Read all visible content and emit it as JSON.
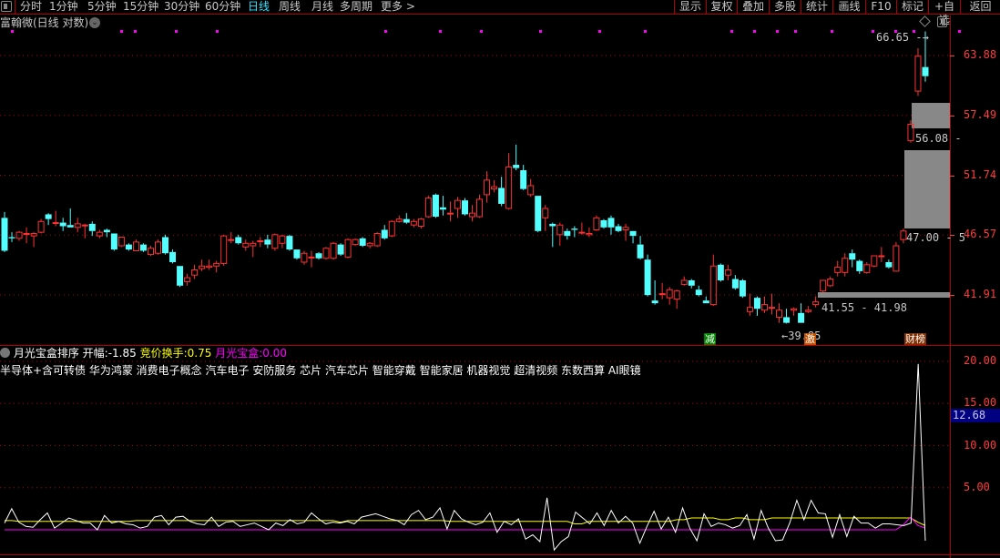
{
  "toolbar": {
    "periods": [
      {
        "label": "分时"
      },
      {
        "label": "1分钟"
      },
      {
        "label": "5分钟"
      },
      {
        "label": "15分钟"
      },
      {
        "label": "30分钟"
      },
      {
        "label": "60分钟"
      },
      {
        "label": "日线",
        "active": true
      },
      {
        "label": "周线"
      },
      {
        "label": "月线"
      },
      {
        "label": "多周期"
      },
      {
        "label": "更多 >"
      }
    ],
    "buttons": [
      {
        "label": "显示"
      },
      {
        "label": "复权"
      },
      {
        "label": "叠加"
      },
      {
        "label": "多股"
      },
      {
        "label": "统计"
      },
      {
        "label": "画线"
      },
      {
        "label": "F10"
      },
      {
        "label": "标记"
      },
      {
        "label": "+自选"
      },
      {
        "label": "返回"
      }
    ]
  },
  "chart": {
    "title": "富翰微(日线 对数)",
    "scale": "log",
    "y_ticks": [
      "63.88",
      "57.49",
      "51.74",
      "46.57",
      "41.91"
    ],
    "colors": {
      "up": "#ff3232",
      "down": "#54ffff",
      "grid": "#b00000",
      "zone": "#888888",
      "signal_dot": "#ff00ff"
    },
    "annotations": {
      "high": "66.65",
      "low": "39.85",
      "zone_top": "56.08",
      "zone_mid": "47.00 - 5",
      "zone_low": "41.55 - 41.98"
    },
    "markers": [
      {
        "label": "减",
        "color": "#008000"
      },
      {
        "label": "激",
        "color": "#c05000"
      },
      {
        "label": "财榜",
        "color": "#803000"
      }
    ],
    "candles_ohlc": [
      [
        48.0,
        48.5,
        45.2,
        45.3
      ],
      [
        46.4,
        46.8,
        46.0,
        46.3
      ],
      [
        46.3,
        46.9,
        46.1,
        46.8
      ],
      [
        46.7,
        47.2,
        45.9,
        46.7
      ],
      [
        46.5,
        46.8,
        45.6,
        46.7
      ],
      [
        46.8,
        47.9,
        46.7,
        47.7
      ],
      [
        48.3,
        48.4,
        47.4,
        47.9
      ],
      [
        47.6,
        48.6,
        47.3,
        47.6
      ],
      [
        47.6,
        48.0,
        46.9,
        47.3
      ],
      [
        47.4,
        48.8,
        47.2,
        47.2
      ],
      [
        47.2,
        48.0,
        46.8,
        47.5
      ],
      [
        47.4,
        47.5,
        46.3,
        47.4
      ],
      [
        47.5,
        47.7,
        46.5,
        46.9
      ],
      [
        46.5,
        47.0,
        46.3,
        46.8
      ],
      [
        47.0,
        47.1,
        46.4,
        46.8
      ],
      [
        46.7,
        46.7,
        45.3,
        45.4
      ],
      [
        45.7,
        46.4,
        45.6,
        46.4
      ],
      [
        45.8,
        45.9,
        45.3,
        45.4
      ],
      [
        45.3,
        46.2,
        45.3,
        46.0
      ],
      [
        45.8,
        45.9,
        45.2,
        45.3
      ],
      [
        45.0,
        45.7,
        44.9,
        45.5
      ],
      [
        45.1,
        46.2,
        45.0,
        46.0
      ],
      [
        46.4,
        46.6,
        45.0,
        45.1
      ],
      [
        45.2,
        45.4,
        44.3,
        44.4
      ],
      [
        44.1,
        44.1,
        42.5,
        42.6
      ],
      [
        42.9,
        43.5,
        42.6,
        43.2
      ],
      [
        43.4,
        44.2,
        43.1,
        43.8
      ],
      [
        43.9,
        44.6,
        43.7,
        44.1
      ],
      [
        44.0,
        44.6,
        43.8,
        44.1
      ],
      [
        44.1,
        44.5,
        43.6,
        44.3
      ],
      [
        44.3,
        46.6,
        44.1,
        46.5
      ],
      [
        46.2,
        46.8,
        45.9,
        46.2
      ],
      [
        46.4,
        46.6,
        45.8,
        45.9
      ],
      [
        45.6,
        46.2,
        45.3,
        45.9
      ],
      [
        45.7,
        46.1,
        44.8,
        45.9
      ],
      [
        46.1,
        46.4,
        45.6,
        46.1
      ],
      [
        46.2,
        46.6,
        45.5,
        45.8
      ],
      [
        45.5,
        46.7,
        45.3,
        46.6
      ],
      [
        45.9,
        46.6,
        45.5,
        46.5
      ],
      [
        46.5,
        46.6,
        45.3,
        45.4
      ],
      [
        45.4,
        45.4,
        44.6,
        44.7
      ],
      [
        44.4,
        45.3,
        44.2,
        45.1
      ],
      [
        44.8,
        45.3,
        44.0,
        44.8
      ],
      [
        45.1,
        45.2,
        44.6,
        44.7
      ],
      [
        44.7,
        45.6,
        44.6,
        45.5
      ],
      [
        44.7,
        46.0,
        44.6,
        45.9
      ],
      [
        45.8,
        45.9,
        44.9,
        45.0
      ],
      [
        44.8,
        46.3,
        44.7,
        46.2
      ],
      [
        45.8,
        46.3,
        45.7,
        46.2
      ],
      [
        46.3,
        46.4,
        45.6,
        45.7
      ],
      [
        45.7,
        46.0,
        45.5,
        45.9
      ],
      [
        45.7,
        46.8,
        45.6,
        46.7
      ],
      [
        47.0,
        47.4,
        46.2,
        46.3
      ],
      [
        46.5,
        47.8,
        46.4,
        47.7
      ],
      [
        47.7,
        48.2,
        47.6,
        47.9
      ],
      [
        47.9,
        48.4,
        47.5,
        47.6
      ],
      [
        47.4,
        47.9,
        47.2,
        47.7
      ],
      [
        47.3,
        48.0,
        47.1,
        47.9
      ],
      [
        48.1,
        49.9,
        48.0,
        49.7
      ],
      [
        50.0,
        50.1,
        48.0,
        48.1
      ],
      [
        48.9,
        49.9,
        48.2,
        48.7
      ],
      [
        48.4,
        49.4,
        47.7,
        48.4
      ],
      [
        48.8,
        49.8,
        48.0,
        49.5
      ],
      [
        49.5,
        49.7,
        48.2,
        48.3
      ],
      [
        48.1,
        49.1,
        47.7,
        48.4
      ],
      [
        48.1,
        50.0,
        48.0,
        49.6
      ],
      [
        50.0,
        52.1,
        49.3,
        51.3
      ],
      [
        50.5,
        51.3,
        50.2,
        50.7
      ],
      [
        50.6,
        51.6,
        49.0,
        49.2
      ],
      [
        48.8,
        53.8,
        48.7,
        52.5
      ],
      [
        52.7,
        54.6,
        52.2,
        52.4
      ],
      [
        52.2,
        52.7,
        50.4,
        50.5
      ],
      [
        50.0,
        51.4,
        49.8,
        50.8
      ],
      [
        49.9,
        49.9,
        46.8,
        46.9
      ],
      [
        48.0,
        49.1,
        46.9,
        48.8
      ],
      [
        47.5,
        47.6,
        45.6,
        47.3
      ],
      [
        46.6,
        47.6,
        45.7,
        47.4
      ],
      [
        46.9,
        47.1,
        46.2,
        46.5
      ],
      [
        47.1,
        47.3,
        46.4,
        47.0
      ],
      [
        46.8,
        47.6,
        46.6,
        46.8
      ],
      [
        46.6,
        47.2,
        46.4,
        46.7
      ],
      [
        47.0,
        48.2,
        46.9,
        48.0
      ],
      [
        47.8,
        47.9,
        47.1,
        47.2
      ],
      [
        48.0,
        48.2,
        46.6,
        47.2
      ],
      [
        47.3,
        47.5,
        46.8,
        46.9
      ],
      [
        47.0,
        47.5,
        46.1,
        47.2
      ],
      [
        46.9,
        46.9,
        45.9,
        46.5
      ],
      [
        45.8,
        46.5,
        44.6,
        44.7
      ],
      [
        44.6,
        45.0,
        41.8,
        41.9
      ],
      [
        41.5,
        43.0,
        41.2,
        41.3
      ],
      [
        42.0,
        42.8,
        41.6,
        42.0
      ],
      [
        41.7,
        42.5,
        41.2,
        42.3
      ],
      [
        41.6,
        42.3,
        40.9,
        42.2
      ],
      [
        42.7,
        43.3,
        42.6,
        43.0
      ],
      [
        43.0,
        43.1,
        42.4,
        42.6
      ],
      [
        42.3,
        42.6,
        41.8,
        41.9
      ],
      [
        41.5,
        41.8,
        41.3,
        41.3
      ],
      [
        41.2,
        45.0,
        41.1,
        44.1
      ],
      [
        44.2,
        44.3,
        42.9,
        43.0
      ],
      [
        43.4,
        44.2,
        43.0,
        43.8
      ],
      [
        43.1,
        43.4,
        42.3,
        42.4
      ],
      [
        43.0,
        43.1,
        41.7,
        41.8
      ],
      [
        40.7,
        42.0,
        40.4,
        41.0
      ],
      [
        41.7,
        41.8,
        40.4,
        40.9
      ],
      [
        40.8,
        41.8,
        40.6,
        41.2
      ],
      [
        41.0,
        42.0,
        40.5,
        41.0
      ],
      [
        40.3,
        41.3,
        39.9,
        40.8
      ],
      [
        40.3,
        40.9,
        39.85,
        39.9
      ],
      [
        40.8,
        41.0,
        40.4,
        40.9
      ],
      [
        40.6,
        41.3,
        39.9,
        39.9
      ],
      [
        40.7,
        41.1,
        40.6,
        40.8
      ],
      [
        41.2,
        41.8,
        41.0,
        41.4
      ],
      [
        42.2,
        43.0,
        42.1,
        43.0
      ],
      [
        42.6,
        43.3,
        42.5,
        43.1
      ],
      [
        43.6,
        44.5,
        43.3,
        44.0
      ],
      [
        43.6,
        45.1,
        43.3,
        44.7
      ],
      [
        45.1,
        45.4,
        44.0,
        44.6
      ],
      [
        44.5,
        44.6,
        43.5,
        43.7
      ],
      [
        43.6,
        44.4,
        43.5,
        44.2
      ],
      [
        44.1,
        44.9,
        44.0,
        44.9
      ],
      [
        44.9,
        45.6,
        44.4,
        44.9
      ],
      [
        44.4,
        44.6,
        43.9,
        44.0
      ],
      [
        43.7,
        46.0,
        43.7,
        45.7
      ],
      [
        46.2,
        47.1,
        45.9,
        46.9
      ],
      [
        55.0,
        57.0,
        54.8,
        56.6
      ],
      [
        60.0,
        64.7,
        59.5,
        63.8
      ],
      [
        62.6,
        66.65,
        61.0,
        61.6
      ]
    ],
    "signal_dot_candles": [
      0,
      24,
      27,
      36,
      45,
      82,
      94,
      103,
      116,
      129,
      139,
      158,
      163,
      168,
      172,
      180,
      189,
      194,
      198,
      208
    ]
  },
  "indicator": {
    "name": "月光宝盒排序",
    "open_label": "开幅:",
    "open_value": "-1.85",
    "auction_label": "竞价换手:",
    "auction_value": "0.75",
    "box_label": "月光宝盒:",
    "box_value": "0.00",
    "tags": "半导体+含可转债 华为鸿蒙 消费电子概念 汽车电子 安防服务 芯片 汽车芯片 智能穿戴 智能家居 机器视觉 超清视频 东数西算 AI眼镜",
    "y_ticks": [
      "20.00",
      "15.00",
      "10.00",
      "5.00"
    ],
    "current_value": "12.68",
    "colors": {
      "main": "#ffffff",
      "auction": "#ffff00",
      "box": "#ff00ff"
    },
    "main_values": [
      0.8,
      2.5,
      0.9,
      0.4,
      0.3,
      1.2,
      2.0,
      0.2,
      0.8,
      1.4,
      1.1,
      0.8,
      0.8,
      0.0,
      1.7,
      0.8,
      1.0,
      0.7,
      0.6,
      0.2,
      0.4,
      1.5,
      1.7,
      0.6,
      1.5,
      1.6,
      1.0,
      0.7,
      0.6,
      1.5,
      0.4,
      0.9,
      1.0,
      0.4,
      0.6,
      0.8,
      0.4,
      0.0,
      0.8,
      0.5,
      1.2,
      0.7,
      0.9,
      2.0,
      1.3,
      0.7,
      0.9,
      0.8,
      1.0,
      0.7,
      1.5,
      1.7,
      1.9,
      1.6,
      1.3,
      1.1,
      0.6,
      1.8,
      2.3,
      1.2,
      1.5,
      2.6,
      0.1,
      2.3,
      1.3,
      0.9,
      0.6,
      0.9,
      2.0,
      -0.3,
      1.0,
      0.6,
      1.3,
      -1.1,
      -0.6,
      -1.4,
      3.8,
      -2.4,
      -1.4,
      -0.8,
      2.1,
      1.4,
      0.7,
      2.0,
      0.5,
      2.3,
      0.8,
      1.6,
      0.8,
      -1.6,
      0.4,
      2.2,
      0.1,
      1.5,
      -0.3,
      2.6,
      0.2,
      -1.3,
      1.9,
      0.4,
      0.8,
      0.6,
      0.2,
      0.5,
      1.8,
      -1.1,
      2.3,
      0.2,
      -1.3,
      -1.2,
      0.8,
      3.5,
      1.2,
      3.5,
      2.0,
      1.9,
      -0.9,
      1.8,
      -0.8,
      1.6,
      0.8,
      0.8,
      0.2,
      0.7,
      0.7,
      0.6,
      0.5,
      0.8,
      19.7,
      -1.3
    ],
    "auction_values": [
      1.1,
      1.1,
      1.0,
      1.0,
      1.0,
      1.0,
      1.0,
      1.0,
      1.0,
      1.0,
      1.0,
      1.0,
      1.0,
      1.0,
      1.0,
      1.0,
      1.0,
      1.0,
      1.1,
      1.1,
      1.1,
      1.1,
      1.1,
      1.1,
      1.1,
      1.1,
      1.1,
      1.1,
      1.1,
      1.1,
      1.1,
      1.1,
      1.1,
      1.1,
      1.1,
      1.1,
      1.1,
      1.1,
      1.1,
      1.1,
      1.1,
      1.1,
      1.1,
      1.1,
      1.1,
      1.1,
      0.9,
      1.1,
      1.1,
      1.1,
      1.1,
      1.1,
      1.1,
      1.1,
      1.1,
      1.1,
      1.1,
      1.1,
      1.1,
      1.1,
      1.1,
      1.0,
      1.0,
      1.0,
      1.0,
      1.0,
      1.0,
      1.0,
      1.0,
      1.0,
      1.0,
      1.0,
      1.0,
      1.0,
      1.0,
      1.0,
      1.0,
      1.0,
      0.7,
      0.7,
      1.0,
      1.0,
      1.0,
      1.0,
      1.0,
      1.0,
      1.0,
      1.0,
      1.0,
      1.0,
      1.0,
      1.0,
      1.2,
      1.2,
      1.4,
      1.4,
      1.4,
      1.4,
      1.2,
      1.2,
      1.4,
      1.4,
      1.2,
      1.2,
      1.2,
      1.4,
      1.4,
      1.4,
      1.4,
      1.4,
      1.4,
      1.4,
      1.4,
      1.4,
      1.4,
      1.4,
      1.4,
      1.4,
      1.4,
      1.4,
      1.4,
      1.4,
      1.4,
      1.4,
      1.4,
      0.9,
      0.5
    ],
    "box_values_flat": 0.0,
    "box_tail": [
      0.0,
      0.6,
      1.5,
      0.5,
      0.2
    ]
  }
}
